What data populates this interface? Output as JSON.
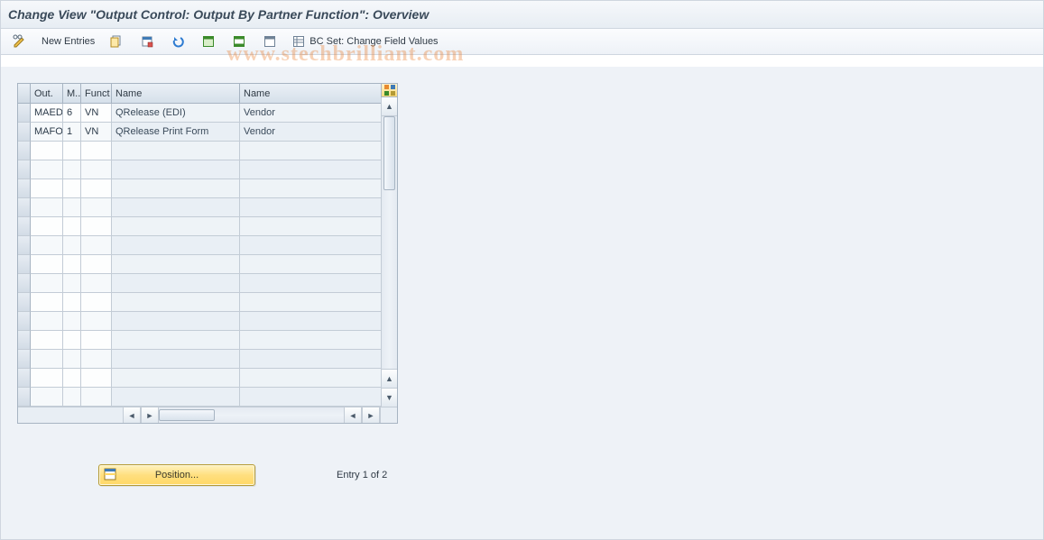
{
  "title": "Change View \"Output Control: Output By Partner Function\": Overview",
  "watermark": "www.stechbrilliant.com",
  "toolbar": {
    "new_entries_label": "New Entries",
    "bcset_label": "BC Set: Change Field Values"
  },
  "table": {
    "columns": {
      "out": "Out.",
      "m": "M...",
      "funct": "Funct",
      "name1": "Name",
      "name2": "Name"
    },
    "rows": [
      {
        "out": "MAED",
        "m": "6",
        "funct": "VN",
        "name1": "QRelease (EDI)",
        "name2": "Vendor"
      },
      {
        "out": "MAFO",
        "m": "1",
        "funct": "VN",
        "name1": "QRelease Print Form",
        "name2": "Vendor"
      }
    ],
    "empty_row_count": 14
  },
  "footer": {
    "position_label": "Position...",
    "entry_label": "Entry 1 of 2"
  }
}
